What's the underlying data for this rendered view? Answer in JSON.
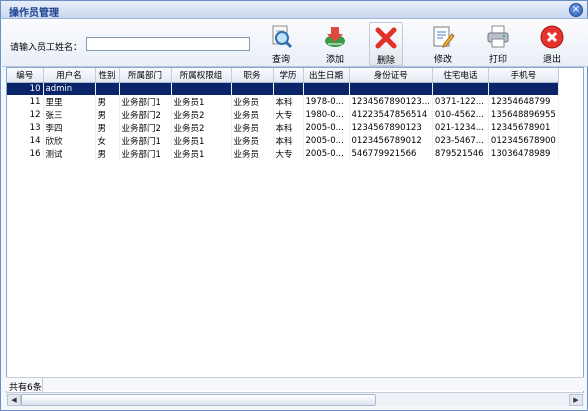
{
  "window": {
    "title": "操作员管理"
  },
  "toolbar": {
    "search_label": "请输入员工姓名：",
    "search_value": "",
    "buttons": {
      "query": "查询",
      "add": "添加",
      "delete": "删除",
      "edit": "修改",
      "print": "打印",
      "exit": "退出"
    }
  },
  "table": {
    "headers": [
      "编号",
      "用户名",
      "性别",
      "所属部门",
      "所属权限组",
      "职务",
      "学历",
      "出生日期",
      "身份证号",
      "住宅电话",
      "手机号"
    ],
    "rows": [
      [
        "10",
        "admin",
        "",
        "",
        "",
        "",
        "",
        "",
        "",
        "",
        ""
      ],
      [
        "11",
        "里里",
        "男",
        "业务部门1",
        "业务员1",
        "业务员",
        "本科",
        "1978-0...",
        "1234567890123...",
        "0371-122...",
        "12354648799"
      ],
      [
        "12",
        "张三",
        "男",
        "业务部门2",
        "业务员2",
        "业务员",
        "大专",
        "1980-0...",
        "41223547856514",
        "010-4562...",
        "135648896955"
      ],
      [
        "13",
        "李四",
        "男",
        "业务部门2",
        "业务员2",
        "业务员",
        "本科",
        "2005-0...",
        "1234567890123",
        "021-1234...",
        "12345678901"
      ],
      [
        "14",
        "欣欣",
        "女",
        "业务部门1",
        "业务员1",
        "业务员",
        "本科",
        "2005-0...",
        "0123456789012",
        "023-5467...",
        "012345678900"
      ],
      [
        "16",
        "测试",
        "男",
        "业务部门1",
        "业务员1",
        "业务员",
        "大专",
        "2005-0...",
        "546779921566",
        "879521546",
        "13036478989"
      ]
    ],
    "selected_row": 0
  },
  "footer": {
    "count": "共有6条"
  },
  "colors": {
    "selection": "#0a246a",
    "title_text": "#1b3f8f",
    "border": "#8ea7cf"
  }
}
